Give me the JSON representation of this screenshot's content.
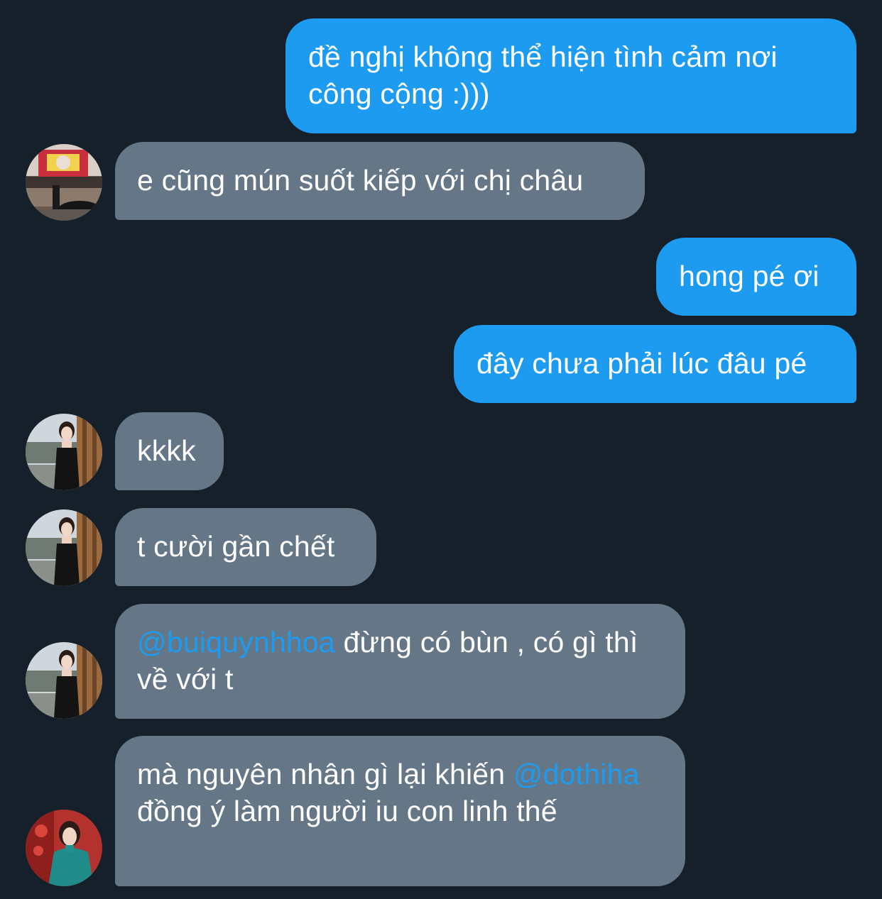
{
  "messages": [
    {
      "id": "m1",
      "direction": "out",
      "text": "đề nghị không thể hiện tình cảm nơi công cộng :)))"
    },
    {
      "id": "m2",
      "direction": "in",
      "avatar": "avatar-street-photo",
      "text": "e cũng mún suốt kiếp với chị châu"
    },
    {
      "id": "m3",
      "direction": "out",
      "text": "hong pé ơi"
    },
    {
      "id": "m4",
      "direction": "out",
      "text": "đây chưa phải lúc đâu pé"
    },
    {
      "id": "m5",
      "direction": "in",
      "avatar": "avatar-black-dress",
      "text": "kkkk"
    },
    {
      "id": "m6",
      "direction": "in",
      "avatar": "avatar-black-dress",
      "text": "t cười gần chết"
    },
    {
      "id": "m7",
      "direction": "in",
      "avatar": "avatar-black-dress",
      "mention": "@buiquynhhoa",
      "text": " đừng có bùn , có gì thì về với t"
    },
    {
      "id": "m8",
      "direction": "in",
      "avatar": "avatar-green-dress",
      "text_before": "mà nguyên nhân gì lại khiến ",
      "mention": "@dothiha",
      "text": " đồng ý làm người iu con linh thế"
    }
  ],
  "colors": {
    "background": "#15202b",
    "outgoing_bubble": "#1d9bf0",
    "incoming_bubble": "#657786",
    "mention": "#1d9bf0",
    "text": "#ffffff"
  }
}
